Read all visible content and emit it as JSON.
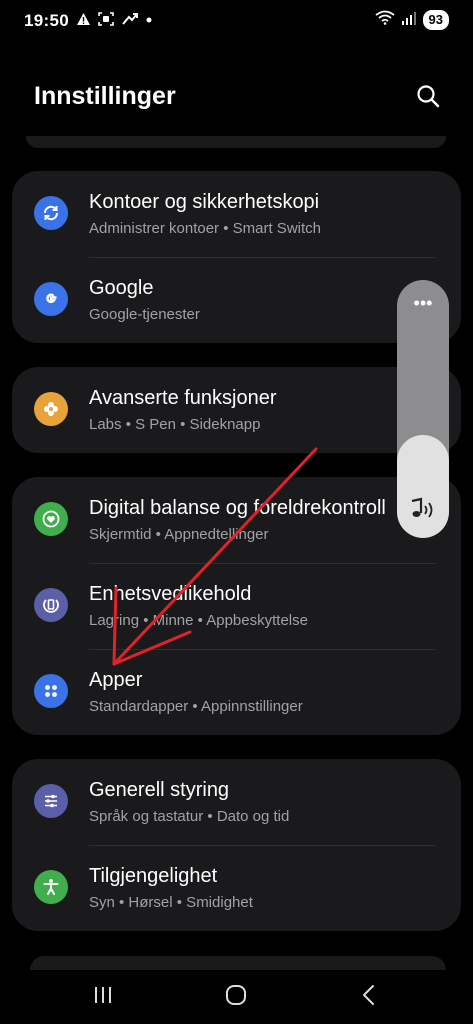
{
  "status_bar": {
    "time": "19:50",
    "battery": "93",
    "icons": [
      "alert-icon",
      "screenshot-icon",
      "missed-call-icon",
      "dot-icon",
      "wifi-icon",
      "signal-icon"
    ]
  },
  "header": {
    "title": "Innstillinger",
    "search_icon": "search-icon"
  },
  "groups": [
    {
      "items": [
        {
          "title": "Kontoer og sikkerhetskopi",
          "subtitle": "Administrer kontoer  •  Smart Switch",
          "icon": "sync-icon",
          "icon_color": "#3a73e8"
        },
        {
          "title": "Google",
          "subtitle": "Google-tjenester",
          "icon": "google-icon",
          "icon_color": "#3a73e8"
        }
      ]
    },
    {
      "items": [
        {
          "title": "Avanserte funksjoner",
          "subtitle": "Labs  •  S Pen  •  Sideknapp",
          "icon": "puzzle-icon",
          "icon_color": "#e8a33a"
        }
      ]
    },
    {
      "items": [
        {
          "title": "Digital balanse og foreldrekontroll",
          "subtitle": "Skjermtid  •  Appnedtellinger",
          "icon": "heart-circle-icon",
          "icon_color": "#3fae4b"
        },
        {
          "title": "Enhetsvedlikehold",
          "subtitle": "Lagring  •  Minne  •  Appbeskyttelse",
          "icon": "battery-care-icon",
          "icon_color": "#5b5fa8"
        },
        {
          "title": "Apper",
          "subtitle": "Standardapper  •  Appinnstillinger",
          "icon": "apps-grid-icon",
          "icon_color": "#3a73e8"
        }
      ]
    },
    {
      "items": [
        {
          "title": "Generell styring",
          "subtitle": "Språk og tastatur  •  Dato og tid",
          "icon": "sliders-icon",
          "icon_color": "#5b5fa8"
        },
        {
          "title": "Tilgjengelighet",
          "subtitle": "Syn  •  Hørsel  •  Smidighet",
          "icon": "accessibility-icon",
          "icon_color": "#3fae4b"
        }
      ]
    }
  ],
  "volume_panel": {
    "level_fraction": 0.4,
    "more_label": "•••",
    "icon": "volume-icon"
  },
  "annotation": {
    "type": "arrow",
    "color": "#e0232a",
    "points_to": "Apper"
  },
  "nav_bar": {
    "recent_icon": "recent-apps-icon",
    "home_icon": "home-icon",
    "back_icon": "back-icon"
  }
}
